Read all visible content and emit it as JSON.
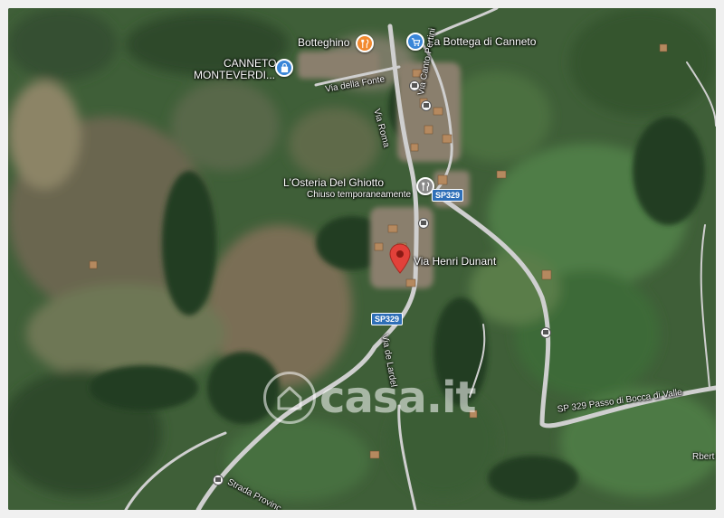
{
  "map": {
    "colors": {
      "pin_red": "#e2413a",
      "food_orange": "#f28a30",
      "shop_blue": "#3a86d8",
      "shield_blue": "#2f6fb8",
      "road": "#cfcfcf"
    },
    "pois": {
      "botteghino": {
        "label": "Botteghino",
        "icon": "fork-knife-icon"
      },
      "bottega": {
        "label": "La Bottega di Canneto",
        "icon": "shopping-cart-icon"
      },
      "canneto": {
        "label_line1": "CANNETO",
        "label_line2": "MONTEVERDI...",
        "icon": "bag-icon"
      },
      "osteria": {
        "label": "L'Osteria Del Ghiotto",
        "sublabel": "Chiuso temporaneamente",
        "icon": "fork-knife-icon"
      },
      "dunant": {
        "label": "Via Henri Dunant",
        "icon": "red-location-pin-icon"
      }
    },
    "roads": {
      "via_fonte": "Via della Fonte",
      "via_canto": "Via Canto Pertini",
      "via_roma": "Via Roma",
      "sp329_a": "SP329",
      "sp329_b": "SP329",
      "via_larderello": "Via de Lardel",
      "sp329_passo": "SP 329 Passo di Bocca di Valle",
      "strada_prov": "Strada Provinc",
      "rbert": "Rbert"
    },
    "watermark": "casa.it"
  }
}
